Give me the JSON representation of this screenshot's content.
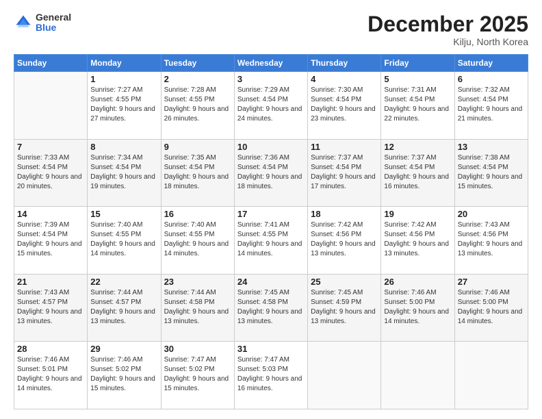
{
  "header": {
    "logo_general": "General",
    "logo_blue": "Blue",
    "month_title": "December 2025",
    "location": "Kilju, North Korea"
  },
  "days_of_week": [
    "Sunday",
    "Monday",
    "Tuesday",
    "Wednesday",
    "Thursday",
    "Friday",
    "Saturday"
  ],
  "weeks": [
    [
      {
        "num": "",
        "sunrise": "",
        "sunset": "",
        "daylight": "",
        "empty": true
      },
      {
        "num": "1",
        "sunrise": "Sunrise: 7:27 AM",
        "sunset": "Sunset: 4:55 PM",
        "daylight": "Daylight: 9 hours and 27 minutes."
      },
      {
        "num": "2",
        "sunrise": "Sunrise: 7:28 AM",
        "sunset": "Sunset: 4:55 PM",
        "daylight": "Daylight: 9 hours and 26 minutes."
      },
      {
        "num": "3",
        "sunrise": "Sunrise: 7:29 AM",
        "sunset": "Sunset: 4:54 PM",
        "daylight": "Daylight: 9 hours and 24 minutes."
      },
      {
        "num": "4",
        "sunrise": "Sunrise: 7:30 AM",
        "sunset": "Sunset: 4:54 PM",
        "daylight": "Daylight: 9 hours and 23 minutes."
      },
      {
        "num": "5",
        "sunrise": "Sunrise: 7:31 AM",
        "sunset": "Sunset: 4:54 PM",
        "daylight": "Daylight: 9 hours and 22 minutes."
      },
      {
        "num": "6",
        "sunrise": "Sunrise: 7:32 AM",
        "sunset": "Sunset: 4:54 PM",
        "daylight": "Daylight: 9 hours and 21 minutes."
      }
    ],
    [
      {
        "num": "7",
        "sunrise": "Sunrise: 7:33 AM",
        "sunset": "Sunset: 4:54 PM",
        "daylight": "Daylight: 9 hours and 20 minutes."
      },
      {
        "num": "8",
        "sunrise": "Sunrise: 7:34 AM",
        "sunset": "Sunset: 4:54 PM",
        "daylight": "Daylight: 9 hours and 19 minutes."
      },
      {
        "num": "9",
        "sunrise": "Sunrise: 7:35 AM",
        "sunset": "Sunset: 4:54 PM",
        "daylight": "Daylight: 9 hours and 18 minutes."
      },
      {
        "num": "10",
        "sunrise": "Sunrise: 7:36 AM",
        "sunset": "Sunset: 4:54 PM",
        "daylight": "Daylight: 9 hours and 18 minutes."
      },
      {
        "num": "11",
        "sunrise": "Sunrise: 7:37 AM",
        "sunset": "Sunset: 4:54 PM",
        "daylight": "Daylight: 9 hours and 17 minutes."
      },
      {
        "num": "12",
        "sunrise": "Sunrise: 7:37 AM",
        "sunset": "Sunset: 4:54 PM",
        "daylight": "Daylight: 9 hours and 16 minutes."
      },
      {
        "num": "13",
        "sunrise": "Sunrise: 7:38 AM",
        "sunset": "Sunset: 4:54 PM",
        "daylight": "Daylight: 9 hours and 15 minutes."
      }
    ],
    [
      {
        "num": "14",
        "sunrise": "Sunrise: 7:39 AM",
        "sunset": "Sunset: 4:54 PM",
        "daylight": "Daylight: 9 hours and 15 minutes."
      },
      {
        "num": "15",
        "sunrise": "Sunrise: 7:40 AM",
        "sunset": "Sunset: 4:55 PM",
        "daylight": "Daylight: 9 hours and 14 minutes."
      },
      {
        "num": "16",
        "sunrise": "Sunrise: 7:40 AM",
        "sunset": "Sunset: 4:55 PM",
        "daylight": "Daylight: 9 hours and 14 minutes."
      },
      {
        "num": "17",
        "sunrise": "Sunrise: 7:41 AM",
        "sunset": "Sunset: 4:55 PM",
        "daylight": "Daylight: 9 hours and 14 minutes."
      },
      {
        "num": "18",
        "sunrise": "Sunrise: 7:42 AM",
        "sunset": "Sunset: 4:56 PM",
        "daylight": "Daylight: 9 hours and 13 minutes."
      },
      {
        "num": "19",
        "sunrise": "Sunrise: 7:42 AM",
        "sunset": "Sunset: 4:56 PM",
        "daylight": "Daylight: 9 hours and 13 minutes."
      },
      {
        "num": "20",
        "sunrise": "Sunrise: 7:43 AM",
        "sunset": "Sunset: 4:56 PM",
        "daylight": "Daylight: 9 hours and 13 minutes."
      }
    ],
    [
      {
        "num": "21",
        "sunrise": "Sunrise: 7:43 AM",
        "sunset": "Sunset: 4:57 PM",
        "daylight": "Daylight: 9 hours and 13 minutes."
      },
      {
        "num": "22",
        "sunrise": "Sunrise: 7:44 AM",
        "sunset": "Sunset: 4:57 PM",
        "daylight": "Daylight: 9 hours and 13 minutes."
      },
      {
        "num": "23",
        "sunrise": "Sunrise: 7:44 AM",
        "sunset": "Sunset: 4:58 PM",
        "daylight": "Daylight: 9 hours and 13 minutes."
      },
      {
        "num": "24",
        "sunrise": "Sunrise: 7:45 AM",
        "sunset": "Sunset: 4:58 PM",
        "daylight": "Daylight: 9 hours and 13 minutes."
      },
      {
        "num": "25",
        "sunrise": "Sunrise: 7:45 AM",
        "sunset": "Sunset: 4:59 PM",
        "daylight": "Daylight: 9 hours and 13 minutes."
      },
      {
        "num": "26",
        "sunrise": "Sunrise: 7:46 AM",
        "sunset": "Sunset: 5:00 PM",
        "daylight": "Daylight: 9 hours and 14 minutes."
      },
      {
        "num": "27",
        "sunrise": "Sunrise: 7:46 AM",
        "sunset": "Sunset: 5:00 PM",
        "daylight": "Daylight: 9 hours and 14 minutes."
      }
    ],
    [
      {
        "num": "28",
        "sunrise": "Sunrise: 7:46 AM",
        "sunset": "Sunset: 5:01 PM",
        "daylight": "Daylight: 9 hours and 14 minutes."
      },
      {
        "num": "29",
        "sunrise": "Sunrise: 7:46 AM",
        "sunset": "Sunset: 5:02 PM",
        "daylight": "Daylight: 9 hours and 15 minutes."
      },
      {
        "num": "30",
        "sunrise": "Sunrise: 7:47 AM",
        "sunset": "Sunset: 5:02 PM",
        "daylight": "Daylight: 9 hours and 15 minutes."
      },
      {
        "num": "31",
        "sunrise": "Sunrise: 7:47 AM",
        "sunset": "Sunset: 5:03 PM",
        "daylight": "Daylight: 9 hours and 16 minutes."
      },
      {
        "num": "",
        "sunrise": "",
        "sunset": "",
        "daylight": "",
        "empty": true
      },
      {
        "num": "",
        "sunrise": "",
        "sunset": "",
        "daylight": "",
        "empty": true
      },
      {
        "num": "",
        "sunrise": "",
        "sunset": "",
        "daylight": "",
        "empty": true
      }
    ]
  ]
}
